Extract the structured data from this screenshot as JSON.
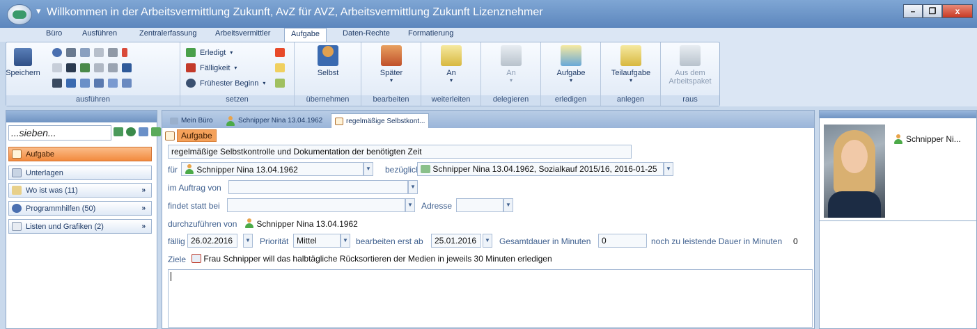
{
  "window": {
    "title": "Willkommen in der Arbeitsvermittlung Zukunft, AvZ für AVZ, Arbeitsvermittlung Zukunft Lizenznehmer",
    "minimize": "–",
    "restore": "❐",
    "close": "x"
  },
  "ribbon_tabs": [
    "Büro",
    "Ausführen",
    "Zentralerfassung",
    "Arbeitsvermittler",
    "Aufgabe",
    "Daten-Rechte",
    "Formatierung"
  ],
  "ribbon": {
    "save_label": "Speichern",
    "group_ausfuehren": "ausführen",
    "group_setzen": "setzen",
    "erledigt": "Erledigt",
    "faelligkeit": "Fälligkeit",
    "fruehester_beginn": "Frühester Beginn",
    "selbst": "Selbst",
    "group_uebernehmen": "übernehmen",
    "spaeter": "Später",
    "group_bearbeiten": "bearbeiten",
    "an_weiter": "An",
    "group_weiterleiten": "weiterleiten",
    "an_deleg": "An",
    "group_delegieren": "delegieren",
    "aufgabe": "Aufgabe",
    "group_erledigen": "erledigen",
    "teilaufgabe": "Teilaufgabe",
    "group_anlegen": "anlegen",
    "aus_dem": "Aus dem",
    "arbeitspaket": "Arbeitspaket",
    "group_raus": "raus"
  },
  "sidebar": {
    "search_value": "...sieben...",
    "items": [
      {
        "label": "Aufgabe"
      },
      {
        "label": "Unterlagen"
      },
      {
        "label": "Wo ist was (11)"
      },
      {
        "label": "Programmhilfen (50)"
      },
      {
        "label": "Listen und Grafiken (2)"
      }
    ]
  },
  "doc_tabs": [
    "Mein Büro",
    "Schnipper Nina 13.04.1962",
    "regelmäßige Selbstkont..."
  ],
  "form": {
    "subtab": "Aufgabe",
    "title_value": "regelmäßige Selbstkontrolle und Dokumentation der benötigten Zeit",
    "fuer_label": "für",
    "fuer_value": "Schnipper Nina 13.04.1962",
    "bezueglich_label": "bezüglich",
    "bezueglich_value": "Schnipper Nina 13.04.1962, Sozialkauf 2015/16, 2016-01-25",
    "im_auftrag_label": "im Auftrag von",
    "findet_statt_label": "findet statt bei",
    "adresse_label": "Adresse",
    "durchzufuehren_label": "durchzuführen von",
    "durchzufuehren_value": "Schnipper Nina 13.04.1962",
    "faellig_label": "fällig",
    "faellig_value": "26.02.2016",
    "prioritaet_label": "Priorität",
    "prioritaet_value": "Mittel",
    "bearbeiten_label": "bearbeiten erst ab",
    "bearbeiten_value": "25.01.2016",
    "gesamtdauer_label": "Gesamtdauer in Minuten",
    "gesamtdauer_value": "0",
    "noch_label": "noch zu leistende Dauer in Minuten",
    "noch_value": "0",
    "ziele_label": "Ziele",
    "ziele_value": "Frau Schnipper will das halbtägliche Rücksortieren der Medien in jeweils 30 Minuten erledigen"
  },
  "right_panel": {
    "name": "Schnipper Ni..."
  }
}
